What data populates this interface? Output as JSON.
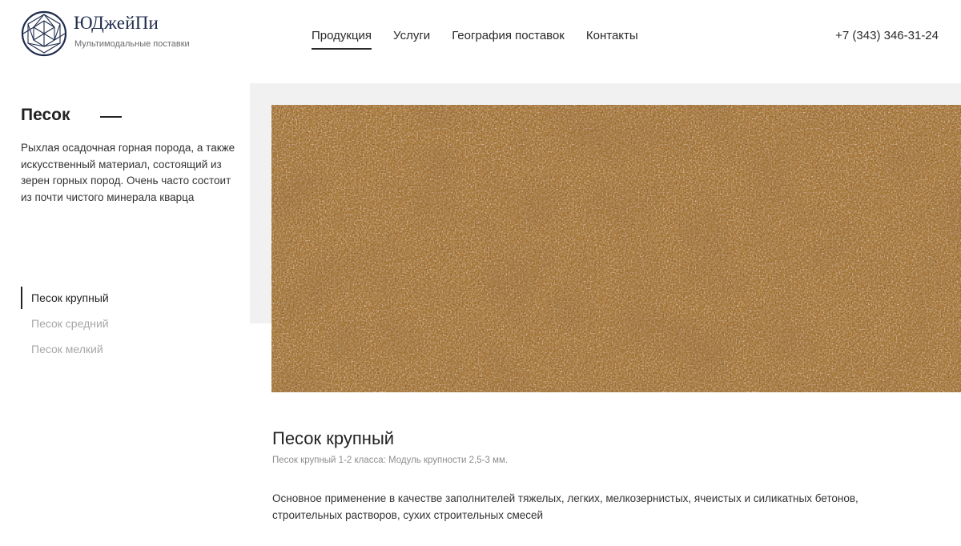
{
  "header": {
    "brand_name": "ЮДжейПи",
    "tagline": "Мультимодальные поставки",
    "nav": [
      {
        "label": "Продукция",
        "active": true
      },
      {
        "label": "Услуги",
        "active": false
      },
      {
        "label": "География поставок",
        "active": false
      },
      {
        "label": "Контакты",
        "active": false
      }
    ],
    "phone": "+7 (343) 346-31-24"
  },
  "product": {
    "title": "Песок",
    "description": "Рыхлая осадочная горная порода, а также искусственный материал, состоящий из зерен горных пород. Очень часто состоит из почти чистого минерала кварца",
    "variants": [
      {
        "label": "Песок крупный",
        "active": true
      },
      {
        "label": "Песок средний",
        "active": false
      },
      {
        "label": "Песок мелкий",
        "active": false
      }
    ]
  },
  "detail": {
    "title": "Песок крупный",
    "subtitle": "Песок крупный 1-2 класса: Модуль крупности 2,5-3 мм.",
    "text": "Основное применение в качестве заполнителей тяжелых, легких, мелкозернистых, ячеистых и силикатных бетонов, строительных растворов, сухих строительных смесей"
  },
  "colors": {
    "accent": "#1f2b4c",
    "muted_text": "#a7a7a7",
    "panel_bg": "#f1f1f1"
  }
}
